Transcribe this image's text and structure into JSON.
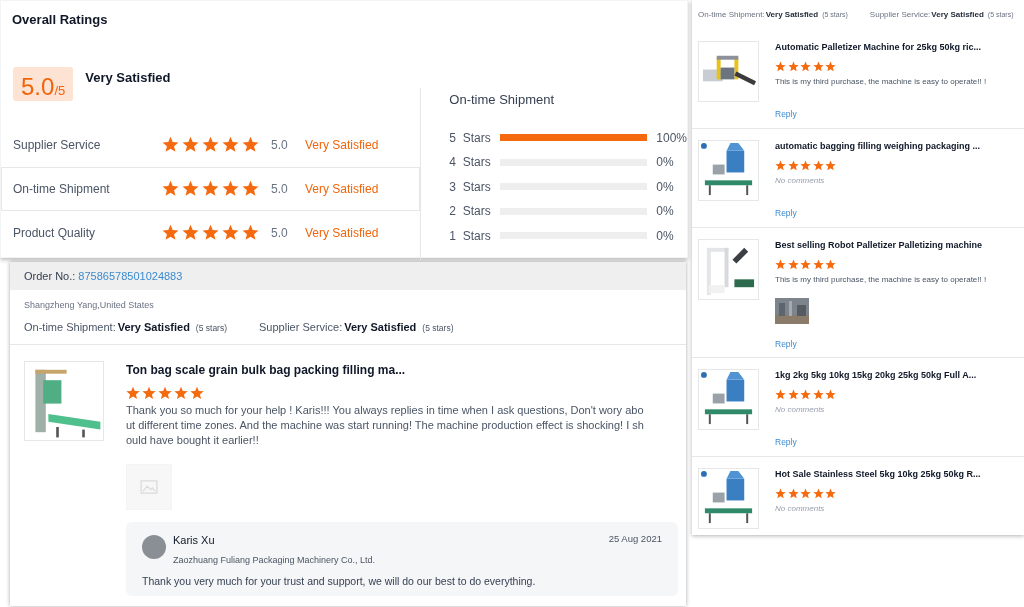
{
  "overall": {
    "title": "Overall Ratings",
    "score": "5.0",
    "score_suffix": "/5",
    "verdict": "Very Satisfied",
    "criteria": [
      {
        "label": "Supplier Service",
        "stars": 5,
        "value": "5.0",
        "verdict": "Very Satisfied",
        "selected": false
      },
      {
        "label": "On-time Shipment",
        "stars": 5,
        "value": "5.0",
        "verdict": "Very Satisfied",
        "selected": true
      },
      {
        "label": "Product Quality",
        "stars": 5,
        "value": "5.0",
        "verdict": "Very Satisfied",
        "selected": false
      }
    ],
    "distribution": {
      "title": "On-time Shipment",
      "rows": [
        {
          "label": "5  Stars",
          "level": 1,
          "percent": "100%"
        },
        {
          "label": "4  Stars",
          "level": 0,
          "percent": "0%"
        },
        {
          "label": "3  Stars",
          "level": 0,
          "percent": "0%"
        },
        {
          "label": "2  Stars",
          "level": 0,
          "percent": "0%"
        },
        {
          "label": "1  Stars",
          "level": 0,
          "percent": "0%"
        }
      ]
    }
  },
  "order": {
    "label": "Order No.:",
    "number": "87586578501024883",
    "buyer": "Shangzheng Yang,United States",
    "ratings": [
      {
        "label": "On-time Shipment:",
        "verdict": "Very Satisfied",
        "stars_text": "(5 stars)"
      },
      {
        "label": "Supplier Service:",
        "verdict": "Very Satisfied",
        "stars_text": "(5 stars)"
      }
    ],
    "review": {
      "product": "Ton bag scale grain bulk bag packing filling ma...",
      "stars": 5,
      "comment": "Thank you so much for your help !  Karis!!!  You always replies in time when I ask questions, Don't wory about different time zones. And the machine was start running! The machine production effect is shocking! I should have bought it earlier!!",
      "reply": {
        "name": "Karis Xu",
        "company": "Zaozhuang Fuliang Packaging Machinery Co., Ltd.",
        "date": "25 Aug 2021",
        "message": "Thank you very much for your trust and support, we will do our best to do everything."
      }
    }
  },
  "review_list": {
    "ratings": [
      {
        "label": "On-time Shipment:",
        "verdict": "Very Satisfied",
        "stars_text": "(5 stars)"
      },
      {
        "label": "Supplier Service:",
        "verdict": "Very Satisfied",
        "stars_text": "(5 stars)"
      }
    ],
    "items": [
      {
        "product": "Automatic Palletizer Machine for 25kg 50kg ric...",
        "stars": 5,
        "kind": "commented",
        "comment": "This is my third purchase, the machine is easy to operate!! !",
        "has_photo": false,
        "reply": "Reply"
      },
      {
        "product": "automatic bagging filling weighing packaging ...",
        "stars": 5,
        "kind": "no_comment",
        "comment": "No comments",
        "has_photo": false,
        "reply": "Reply"
      },
      {
        "product": "Best selling Robot Palletizer Palletizing machine",
        "stars": 5,
        "kind": "commented",
        "comment": "This is my third purchase, the machine is easy to operate!! !",
        "has_photo": true,
        "reply": "Reply"
      },
      {
        "product": "1kg 2kg 5kg 10kg 15kg 20kg 25kg 50kg Full A...",
        "stars": 5,
        "kind": "no_comment",
        "comment": "No comments",
        "has_photo": false,
        "reply": "Reply"
      },
      {
        "product": "Hot Sale Stainless Steel 5kg 10kg 25kg 50kg R...",
        "stars": 5,
        "kind": "no_comment",
        "comment": "No comments",
        "has_photo": false
      }
    ]
  }
}
